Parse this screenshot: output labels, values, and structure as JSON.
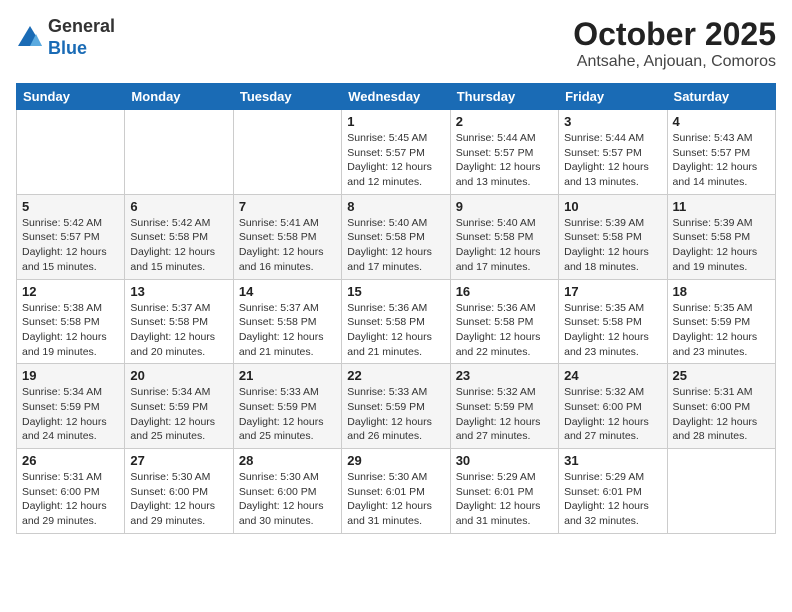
{
  "header": {
    "logo_line1": "General",
    "logo_line2": "Blue",
    "month": "October 2025",
    "location": "Antsahe, Anjouan, Comoros"
  },
  "weekdays": [
    "Sunday",
    "Monday",
    "Tuesday",
    "Wednesday",
    "Thursday",
    "Friday",
    "Saturday"
  ],
  "weeks": [
    [
      {
        "day": "",
        "info": ""
      },
      {
        "day": "",
        "info": ""
      },
      {
        "day": "",
        "info": ""
      },
      {
        "day": "1",
        "info": "Sunrise: 5:45 AM\nSunset: 5:57 PM\nDaylight: 12 hours\nand 12 minutes."
      },
      {
        "day": "2",
        "info": "Sunrise: 5:44 AM\nSunset: 5:57 PM\nDaylight: 12 hours\nand 13 minutes."
      },
      {
        "day": "3",
        "info": "Sunrise: 5:44 AM\nSunset: 5:57 PM\nDaylight: 12 hours\nand 13 minutes."
      },
      {
        "day": "4",
        "info": "Sunrise: 5:43 AM\nSunset: 5:57 PM\nDaylight: 12 hours\nand 14 minutes."
      }
    ],
    [
      {
        "day": "5",
        "info": "Sunrise: 5:42 AM\nSunset: 5:57 PM\nDaylight: 12 hours\nand 15 minutes."
      },
      {
        "day": "6",
        "info": "Sunrise: 5:42 AM\nSunset: 5:58 PM\nDaylight: 12 hours\nand 15 minutes."
      },
      {
        "day": "7",
        "info": "Sunrise: 5:41 AM\nSunset: 5:58 PM\nDaylight: 12 hours\nand 16 minutes."
      },
      {
        "day": "8",
        "info": "Sunrise: 5:40 AM\nSunset: 5:58 PM\nDaylight: 12 hours\nand 17 minutes."
      },
      {
        "day": "9",
        "info": "Sunrise: 5:40 AM\nSunset: 5:58 PM\nDaylight: 12 hours\nand 17 minutes."
      },
      {
        "day": "10",
        "info": "Sunrise: 5:39 AM\nSunset: 5:58 PM\nDaylight: 12 hours\nand 18 minutes."
      },
      {
        "day": "11",
        "info": "Sunrise: 5:39 AM\nSunset: 5:58 PM\nDaylight: 12 hours\nand 19 minutes."
      }
    ],
    [
      {
        "day": "12",
        "info": "Sunrise: 5:38 AM\nSunset: 5:58 PM\nDaylight: 12 hours\nand 19 minutes."
      },
      {
        "day": "13",
        "info": "Sunrise: 5:37 AM\nSunset: 5:58 PM\nDaylight: 12 hours\nand 20 minutes."
      },
      {
        "day": "14",
        "info": "Sunrise: 5:37 AM\nSunset: 5:58 PM\nDaylight: 12 hours\nand 21 minutes."
      },
      {
        "day": "15",
        "info": "Sunrise: 5:36 AM\nSunset: 5:58 PM\nDaylight: 12 hours\nand 21 minutes."
      },
      {
        "day": "16",
        "info": "Sunrise: 5:36 AM\nSunset: 5:58 PM\nDaylight: 12 hours\nand 22 minutes."
      },
      {
        "day": "17",
        "info": "Sunrise: 5:35 AM\nSunset: 5:58 PM\nDaylight: 12 hours\nand 23 minutes."
      },
      {
        "day": "18",
        "info": "Sunrise: 5:35 AM\nSunset: 5:59 PM\nDaylight: 12 hours\nand 23 minutes."
      }
    ],
    [
      {
        "day": "19",
        "info": "Sunrise: 5:34 AM\nSunset: 5:59 PM\nDaylight: 12 hours\nand 24 minutes."
      },
      {
        "day": "20",
        "info": "Sunrise: 5:34 AM\nSunset: 5:59 PM\nDaylight: 12 hours\nand 25 minutes."
      },
      {
        "day": "21",
        "info": "Sunrise: 5:33 AM\nSunset: 5:59 PM\nDaylight: 12 hours\nand 25 minutes."
      },
      {
        "day": "22",
        "info": "Sunrise: 5:33 AM\nSunset: 5:59 PM\nDaylight: 12 hours\nand 26 minutes."
      },
      {
        "day": "23",
        "info": "Sunrise: 5:32 AM\nSunset: 5:59 PM\nDaylight: 12 hours\nand 27 minutes."
      },
      {
        "day": "24",
        "info": "Sunrise: 5:32 AM\nSunset: 6:00 PM\nDaylight: 12 hours\nand 27 minutes."
      },
      {
        "day": "25",
        "info": "Sunrise: 5:31 AM\nSunset: 6:00 PM\nDaylight: 12 hours\nand 28 minutes."
      }
    ],
    [
      {
        "day": "26",
        "info": "Sunrise: 5:31 AM\nSunset: 6:00 PM\nDaylight: 12 hours\nand 29 minutes."
      },
      {
        "day": "27",
        "info": "Sunrise: 5:30 AM\nSunset: 6:00 PM\nDaylight: 12 hours\nand 29 minutes."
      },
      {
        "day": "28",
        "info": "Sunrise: 5:30 AM\nSunset: 6:00 PM\nDaylight: 12 hours\nand 30 minutes."
      },
      {
        "day": "29",
        "info": "Sunrise: 5:30 AM\nSunset: 6:01 PM\nDaylight: 12 hours\nand 31 minutes."
      },
      {
        "day": "30",
        "info": "Sunrise: 5:29 AM\nSunset: 6:01 PM\nDaylight: 12 hours\nand 31 minutes."
      },
      {
        "day": "31",
        "info": "Sunrise: 5:29 AM\nSunset: 6:01 PM\nDaylight: 12 hours\nand 32 minutes."
      },
      {
        "day": "",
        "info": ""
      }
    ]
  ]
}
